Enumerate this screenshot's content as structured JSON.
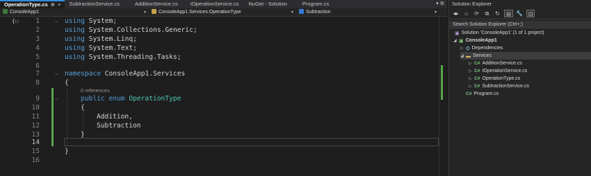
{
  "tabs": [
    {
      "label": "OperationType.cs",
      "active": true
    },
    {
      "label": "SubtractionService.cs"
    },
    {
      "label": "AdditionService.cs"
    },
    {
      "label": "IOperationService.cs"
    },
    {
      "label": "NuGet - Solution"
    },
    {
      "label": "Program.cs"
    }
  ],
  "tab_icons": {
    "pin": "⊕",
    "close": "×",
    "overflow": "▾ ⚙"
  },
  "navbar": {
    "project": "ConsoleApp1",
    "type": "ConsoleApp1.Services.OperationType",
    "member": "Subtraction"
  },
  "editor": {
    "codelens": "0 references",
    "lines": [
      {
        "n": "1"
      },
      {
        "n": "2"
      },
      {
        "n": "3"
      },
      {
        "n": "4"
      },
      {
        "n": "5"
      },
      {
        "n": "6"
      },
      {
        "n": "7"
      },
      {
        "n": "8"
      },
      {
        "n": "9"
      },
      {
        "n": "10"
      },
      {
        "n": "11"
      },
      {
        "n": "12"
      },
      {
        "n": "13"
      },
      {
        "n": "14"
      },
      {
        "n": "15"
      },
      {
        "n": "16"
      }
    ],
    "code": {
      "l1": [
        "using",
        " System",
        ";"
      ],
      "l2": [
        "using",
        " System.Collections.Generic",
        ";"
      ],
      "l3": [
        "using",
        " System.Linq",
        ";"
      ],
      "l4": [
        "using",
        " System.Text",
        ";"
      ],
      "l5": [
        "using",
        " System.Threading.Tasks",
        ";"
      ],
      "l7": [
        "namespace",
        " ConsoleApp1.Services"
      ],
      "l8": "{",
      "l9": [
        "public",
        " ",
        "enum",
        " ",
        "OperationType"
      ],
      "l10": "{",
      "l11": "Addition,",
      "l12": "Subtraction",
      "l13": "}",
      "l15": "}"
    }
  },
  "solution_explorer": {
    "title": "Solution Explorer",
    "search_placeholder": "Search Solution Explorer (Ctrl+;)",
    "toolbar": {
      "home": "⌂",
      "sync": "⟳",
      "collapse": "⊟",
      "settings": "🔧",
      "preview": "⊡"
    },
    "tree": [
      {
        "label": "Solution 'ConsoleApp1' (1 of 1 project)",
        "icon": "solution-icon"
      },
      {
        "label": "ConsoleApp1",
        "icon": "csharp-project-icon",
        "bold": true
      },
      {
        "label": "Dependencies",
        "icon": "dependencies-icon"
      },
      {
        "label": "Services",
        "icon": "folder-icon",
        "selected": true
      },
      {
        "label": "AdditionService.cs",
        "icon": "csharp-file-icon"
      },
      {
        "label": "IOperationService.cs",
        "icon": "csharp-file-icon"
      },
      {
        "label": "OperationType.cs",
        "icon": "csharp-file-icon"
      },
      {
        "label": "SubtractionService.cs",
        "icon": "csharp-file-icon"
      },
      {
        "label": "Program.cs",
        "icon": "csharp-file-icon"
      }
    ],
    "cs_badge": "C#"
  },
  "colors": {
    "accent": "#2f8fe0",
    "change_bar": "#57a64a",
    "keyword": "#569cd6",
    "type": "#4ec9b0"
  }
}
